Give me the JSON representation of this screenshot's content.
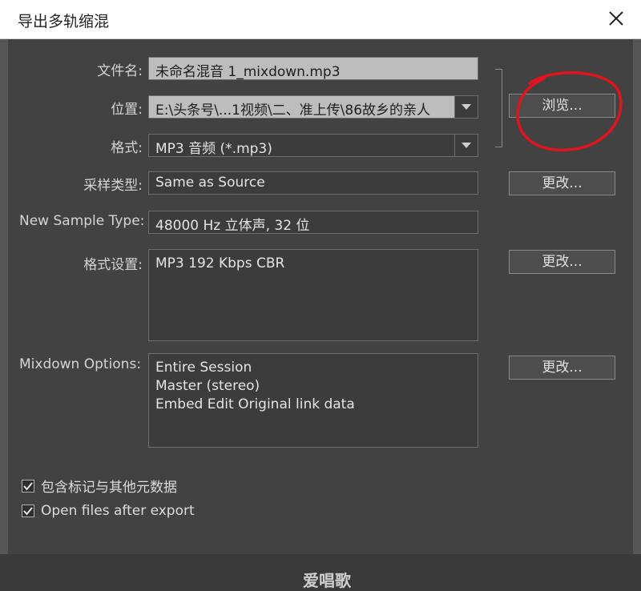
{
  "window": {
    "title": "导出多轨缩混"
  },
  "fields": {
    "filename_label": "文件名:",
    "filename_value": "未命名混音 1_mixdown.mp3",
    "location_label": "位置:",
    "location_value": "E:\\头条号\\...1视频\\二、准上传\\86故乡的亲人",
    "format_label": "格式:",
    "format_value": "MP3 音频 (*.mp3)",
    "sample_type_label": "采样类型:",
    "sample_type_value": "Same as Source",
    "new_sample_type_label": "New Sample Type:",
    "new_sample_type_value": "48000 Hz 立体声, 32 位",
    "format_settings_label": "格式设置:",
    "format_settings_value": "MP3 192 Kbps CBR",
    "mixdown_options_label": "Mixdown Options:",
    "mixdown_options_lines": [
      "Entire Session",
      "Master (stereo)",
      "Embed Edit Original link data"
    ]
  },
  "buttons": {
    "browse": "浏览...",
    "change_sample": "更改...",
    "change_format": "更改...",
    "change_mixdown": "更改..."
  },
  "checkboxes": [
    {
      "label": "包含标记与其他元数据",
      "checked": true
    },
    {
      "label": "Open files after export",
      "checked": true
    }
  ],
  "annotation": {
    "circle_color": "#e0141e"
  },
  "watermark": "爱唱歌"
}
